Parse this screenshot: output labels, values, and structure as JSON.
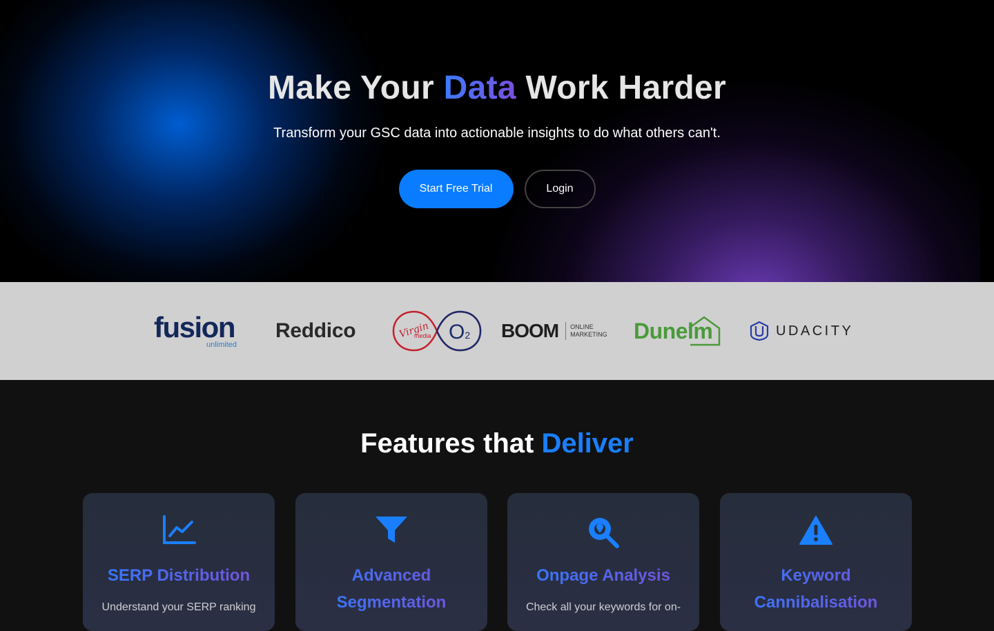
{
  "hero": {
    "title_before": "Make Your ",
    "title_accent": "Data",
    "title_after": " Work Harder",
    "subtitle": "Transform your GSC data into actionable insights to do what others can't.",
    "primary_button": "Start Free Trial",
    "secondary_button": "Login"
  },
  "logos": {
    "fusion": "fusion",
    "fusion_sub": "unlimited",
    "reddico": "Reddico",
    "virgin": "Virgin",
    "virgin_sub": "media",
    "o2": "O",
    "o2_sub": "2",
    "boom": "BOOM",
    "boom_line1": "ONLINE",
    "boom_line2": "MARKETING",
    "dunelm": "Dunelm",
    "udacity": "UDACITY"
  },
  "features": {
    "title_before": "Features that ",
    "title_accent": "Deliver",
    "cards": [
      {
        "icon": "line-chart-icon",
        "title": "SERP Distribution",
        "desc": "Understand your SERP ranking"
      },
      {
        "icon": "filter-icon",
        "title": "Advanced Segmentation",
        "desc": ""
      },
      {
        "icon": "search-icon",
        "title": "Onpage Analysis",
        "desc": "Check all your keywords for on-"
      },
      {
        "icon": "warning-icon",
        "title": "Keyword Cannibalisation",
        "desc": ""
      }
    ]
  },
  "colors": {
    "primary": "#0a7cff",
    "accent_purple": "#7a4fdd",
    "logo_bar": "#d0d0d0"
  }
}
